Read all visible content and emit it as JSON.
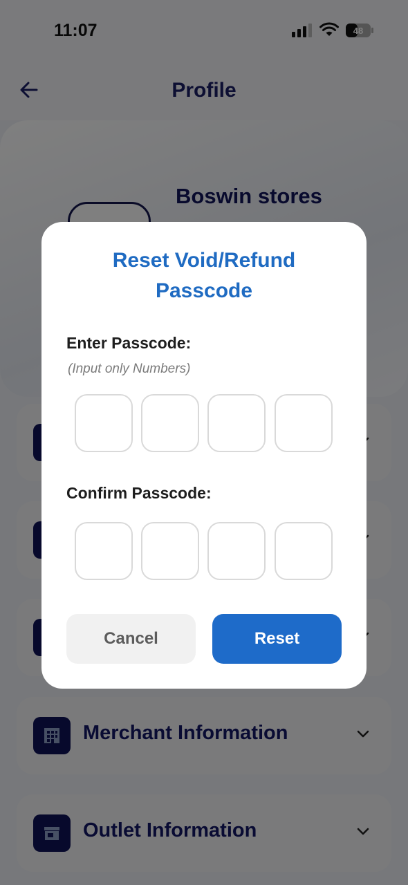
{
  "status_bar": {
    "time": "11:07",
    "battery_level": "48"
  },
  "header": {
    "title": "Profile"
  },
  "profile": {
    "store_name": "Boswin stores"
  },
  "sections": [
    {
      "label": "",
      "icon": "document-icon"
    },
    {
      "label": "",
      "icon": "document-icon"
    },
    {
      "label": "",
      "icon": "document-icon"
    },
    {
      "label": "Merchant Information",
      "icon": "building-icon"
    },
    {
      "label": "Outlet Information",
      "icon": "store-icon"
    }
  ],
  "modal": {
    "title_line1": "Reset Void/Refund",
    "title_line2": "Passcode",
    "enter_label": "Enter Passcode:",
    "enter_hint": "(Input only Numbers)",
    "confirm_label": "Confirm Passcode:",
    "cancel_label": "Cancel",
    "reset_label": "Reset"
  },
  "colors": {
    "accent": "#1e6bc9",
    "navy": "#0f1259",
    "title_blue": "#1f6bc2"
  }
}
